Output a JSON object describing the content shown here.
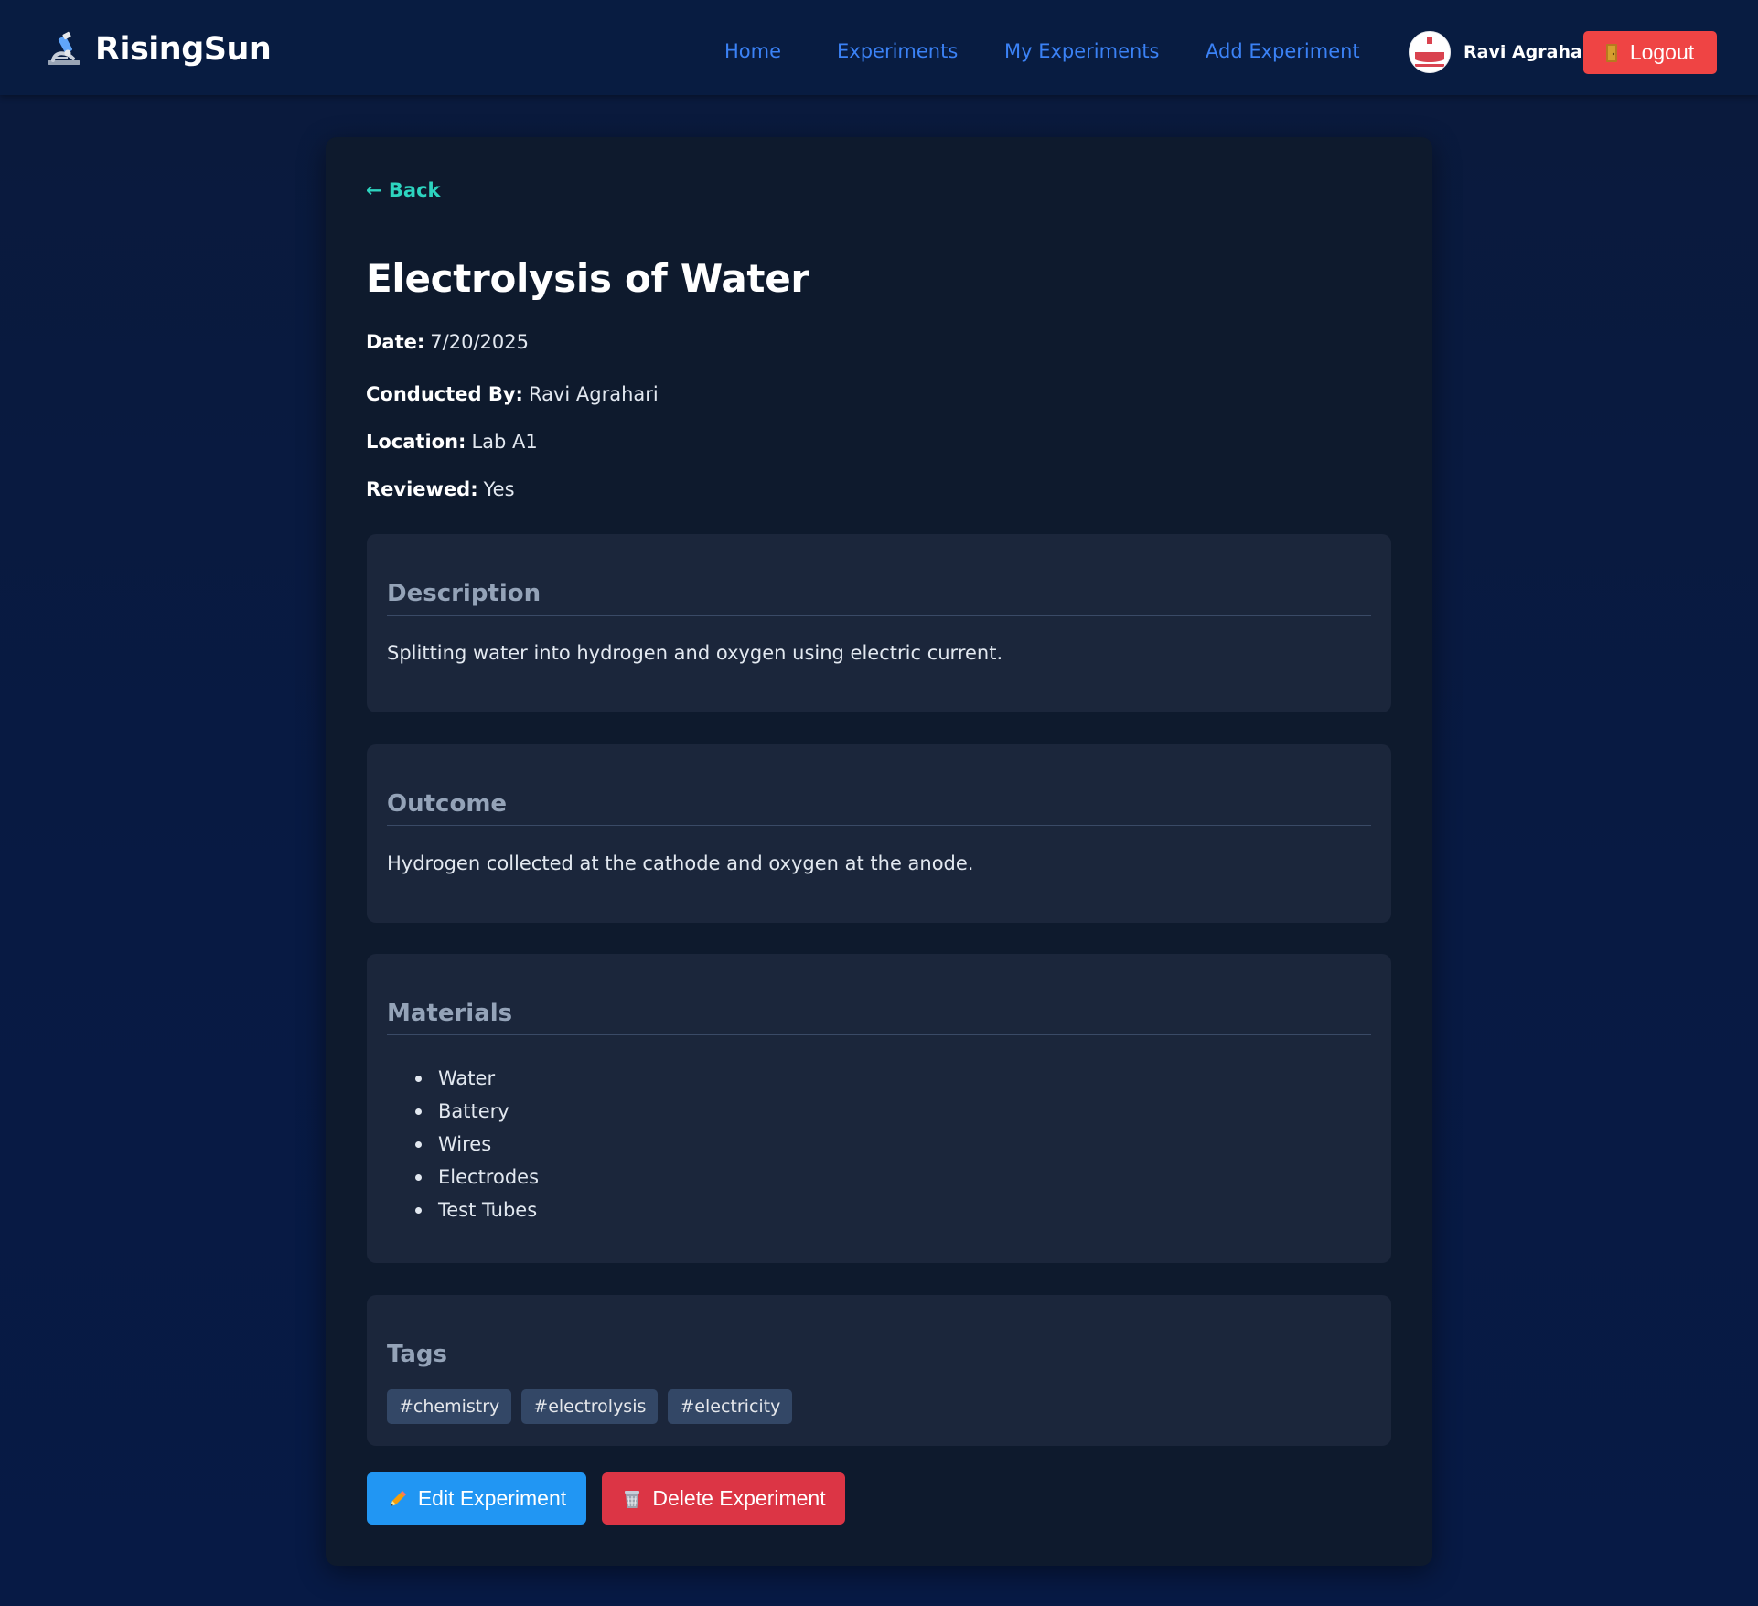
{
  "header": {
    "brand": "RisingSun",
    "brand_icon": "microscope-icon",
    "nav": [
      {
        "label": "Home"
      },
      {
        "label": "Experiments"
      },
      {
        "label": "My Experiments"
      },
      {
        "label": "Add Experiment"
      }
    ],
    "user_name": "Ravi Agrahari",
    "logout_label": "Logout",
    "logout_icon": "door-icon"
  },
  "colors": {
    "background": "#081a43",
    "card": "#0e1a2d",
    "section": "#1b263b",
    "nav_link": "#3b82f6",
    "back_link": "#2dd4bf",
    "logout": "#ef4444",
    "edit": "#2196f3",
    "delete": "#dc3545"
  },
  "experiment": {
    "back_label": "← Back",
    "title": "Electrolysis of Water",
    "meta": [
      {
        "label": "Date:",
        "value": "7/20/2025"
      },
      {
        "label": "Conducted By:",
        "value": "Ravi Agrahari"
      },
      {
        "label": "Location:",
        "value": "Lab A1"
      },
      {
        "label": "Reviewed:",
        "value": "Yes"
      }
    ],
    "description": {
      "title": "Description",
      "text": "Splitting water into hydrogen and oxygen using electric current."
    },
    "outcome": {
      "title": "Outcome",
      "text": "Hydrogen collected at the cathode and oxygen at the anode."
    },
    "materials": {
      "title": "Materials",
      "items": [
        "Water",
        "Battery",
        "Wires",
        "Electrodes",
        "Test Tubes"
      ]
    },
    "tags": {
      "title": "Tags",
      "items": [
        "#chemistry",
        "#electrolysis",
        "#electricity"
      ]
    },
    "actions": {
      "edit_label": "Edit Experiment",
      "edit_icon": "pencil-icon",
      "delete_label": "Delete Experiment",
      "delete_icon": "wastebasket-icon"
    }
  }
}
